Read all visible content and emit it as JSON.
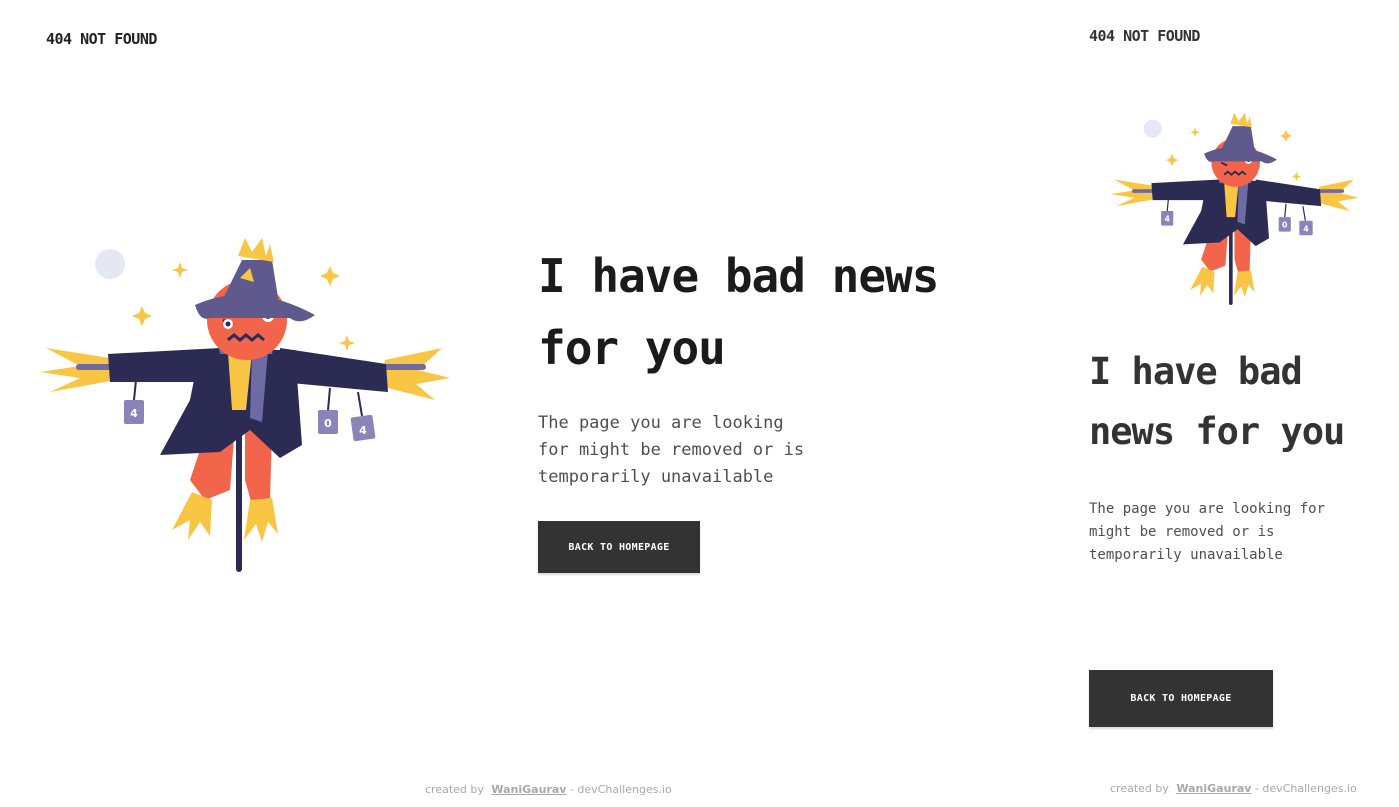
{
  "brand": "404 NOT FOUND",
  "headline": {
    "desktop_line1": "I have bad news",
    "desktop_line2": "for you",
    "mobile_line1": "I have bad",
    "mobile_line2": "news for you"
  },
  "description": {
    "desktop_lines": [
      "The page you are looking",
      "for might be removed or is",
      "temporarily unavailable"
    ],
    "mobile_lines": [
      "The page you are looking for",
      "might be removed or is",
      "temporarily unavailable"
    ]
  },
  "button_label": "BACK TO HOMEPAGE",
  "footer": {
    "prefix": "created by",
    "author": "WaniGaurav",
    "suffix": "- devChallenges.io"
  },
  "illustration": {
    "name": "scarecrow-illustration",
    "can_labels": [
      "4",
      "0",
      "4"
    ],
    "colors": {
      "hat": "#5f5a8e",
      "coat": "#2b2b54",
      "face": "#f2654b",
      "straw": "#f8c544",
      "can": "#8a85b8",
      "moon": "#e3e8f3"
    }
  }
}
